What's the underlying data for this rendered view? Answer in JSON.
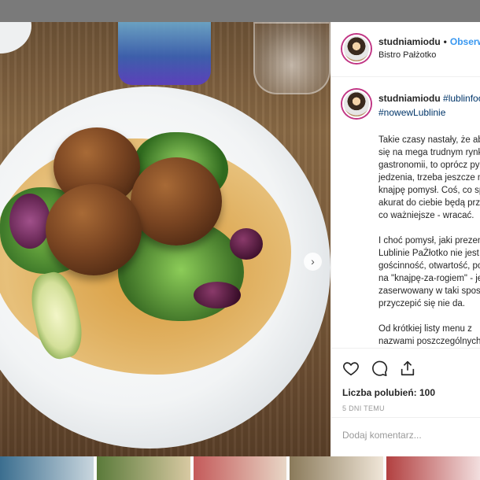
{
  "post": {
    "username": "studniamiodu",
    "separator": "•",
    "follow_label": "Obserwuj",
    "location": "Bistro Pałżotko"
  },
  "caption": {
    "username": "studniamiodu",
    "hashtag_1": "#lublinfood",
    "hashtag_2": "#nowewLublinie",
    "lines": [
      "Takie czasy nastały, że aby",
      "się na mega trudnym rynku",
      "gastronomii, to oprócz pysznego",
      "jedzenia, trzeba jeszcze mieć na",
      "knajpę pomysł. Coś, co sprawi, że",
      "akurat do ciebie będą przychodzić i",
      "co ważniejsze - wracać."
    ],
    "lines_2": [
      "I choć pomysł, jaki prezentuje na",
      "Lublinie PaŻłotko nie jest nowy -",
      "gościnność, otwartość, postawienie",
      "na \"knajpę-za-rogiem\" - jest tak",
      "zaserwowany w taki sposób, że",
      "przyczepić się nie da."
    ],
    "lines_3": [
      "Od krótkiej listy menu z",
      "nazwami poszczególnych"
    ]
  },
  "actions": {
    "like_icon": "heart-icon",
    "comment_icon": "comment-icon",
    "share_icon": "share-icon",
    "likes_text": "Liczba polubień: 100",
    "date": "5 DNI TEMU"
  },
  "comment": {
    "placeholder": "Dodaj komentarz..."
  },
  "carousel": {
    "next_icon": "chevron-right-icon",
    "next_glyph": "›",
    "slide_count": 4,
    "active_slide": 1
  },
  "colors": {
    "accent": "#3897f0",
    "hashtag": "#003569",
    "muted": "#999999"
  }
}
